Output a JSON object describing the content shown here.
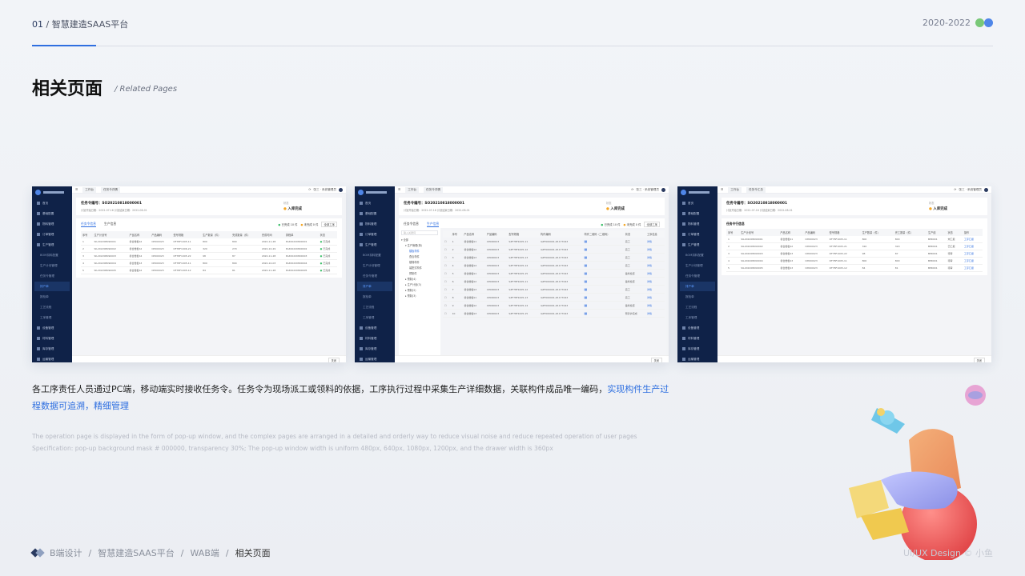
{
  "header": {
    "number": "01",
    "separator": "/",
    "platform": "智慧建造SAAS平台",
    "years": "2020-2022"
  },
  "page": {
    "title": "相关页面",
    "subtitle": "/ Related Pages"
  },
  "shot1": {
    "sidebar": [
      "首页",
      "基础配置",
      "物料管理",
      "订单管理",
      "生产管理",
      "BOM扣料配置",
      "生产计划管理",
      "任务令管理",
      "排产单",
      "报检单",
      "工艺流程",
      "工序管理",
      "设备管理",
      "材料管理",
      "库存管理",
      "运输管理"
    ],
    "active_index": 8,
    "top_tabs": [
      "工作台",
      "任务令详情"
    ],
    "user": "张三 · 系统管理员",
    "task_no": "任务令编号：SO20210818000001",
    "meta": "计划开始日期：2022-07-16    计划结束日期：2022-08-01",
    "status_label": "状态",
    "status": "入库完成",
    "tabs": [
      "任务令信息",
      "生产信息"
    ],
    "legend_done": "已完成 10 件",
    "legend_todo": "未完成 0 件",
    "legend_btn": "全部工序",
    "columns": [
      "序号",
      "生产计划号",
      "产品名称",
      "产品编码",
      "型号规格",
      "生产数量（件）",
      "完成数量（件）",
      "完成时间",
      "排程单",
      "状态"
    ],
    "rows": [
      [
        "1",
        "SIL202208090001",
        "叠合楼板S2",
        "CP000023",
        "DF78F1005-11",
        "800",
        "800",
        "2022-11-28",
        "PLZ20220800001",
        "已完成"
      ],
      [
        "2",
        "SIL202208090002",
        "叠合楼板S2",
        "CP000023",
        "DF78F1006-21",
        "320",
        "270",
        "2022-10-29",
        "PLZ20220800002",
        "已完成"
      ],
      [
        "3",
        "SIL202208090003",
        "叠合楼板S4",
        "CP000023",
        "DF78F1005-22",
        "98",
        "87",
        "2022-11-28",
        "PLZ20220800003",
        "已完成"
      ],
      [
        "4",
        "SIL202208090004",
        "叠合楼板S3",
        "CP000023",
        "DF78F1005-11",
        "800",
        "800",
        "2022-10-03",
        "PLZ20220800004",
        "已完成"
      ],
      [
        "5",
        "SIL202208090005",
        "叠合楼板S2",
        "CP000023",
        "DF78F1005-12",
        "84",
        "81",
        "2022-11-28",
        "PLZ20220800005",
        "已完成"
      ]
    ],
    "footer_btn": "关闭"
  },
  "shot2": {
    "top_tabs": [
      "工作台",
      "任务令详情"
    ],
    "user": "张三 · 系统管理员",
    "tree_search": "输入关键词",
    "tree": [
      {
        "label": "▾ 全部",
        "level": 1
      },
      {
        "label": "▾ 生产管理(单)",
        "level": 2
      },
      {
        "label": "楼板构件",
        "level": 3,
        "sel": true
      },
      {
        "label": "叠合构件",
        "level": 3
      },
      {
        "label": "楼梯构件",
        "level": 3
      },
      {
        "label": "装配式构件",
        "level": 3
      },
      {
        "label": "预制件",
        "level": 3
      },
      {
        "label": "▸ 预制(4)",
        "level": 2
      },
      {
        "label": "▸ 生产计划(3)",
        "level": 2
      },
      {
        "label": "▸ 预制(2)",
        "level": 2
      },
      {
        "label": "▸ 预制(3)",
        "level": 2
      }
    ],
    "columns": [
      "",
      "序号",
      "产品名称",
      "产品编码",
      "型号规格",
      "构件编码",
      "构件二维码（二维码）",
      "状态",
      "工序信息"
    ],
    "rows": [
      [
        "1",
        "叠合楼板S1",
        "CP000023",
        "SZF78F1005-11",
        "GZF000001-Z1177043"
      ],
      [
        "2",
        "叠合楼板S2",
        "CP000023",
        "SZF78F1005-12",
        "GZF000001-Z1177043"
      ],
      [
        "3",
        "叠合楼板S3",
        "CP000023",
        "SZF78F1005-13",
        "GZF000001-Z1177043"
      ],
      [
        "4",
        "叠合楼板S4",
        "CP000023",
        "SZF78F1005-14",
        "GZF000001-Z1177043"
      ],
      [
        "5",
        "叠合楼板S1",
        "CP000023",
        "SZF78F1005-15",
        "GZF000001-Z1177043"
      ],
      [
        "6",
        "叠合楼板S2",
        "CP000023",
        "SZF78F1005-11",
        "GZF000001-Z1177043"
      ],
      [
        "7",
        "叠合楼板S3",
        "CP000023",
        "SZF78F1005-12",
        "GZF000001-Z1177043"
      ],
      [
        "8",
        "叠合楼板S1",
        "CP000023",
        "SZF78F1005-13",
        "GZF000001-Z1177043"
      ],
      [
        "9",
        "叠合楼板S2",
        "CP000023",
        "SZF78F1005-14",
        "GZF000001-Z1177043"
      ],
      [
        "10",
        "叠合楼板S3",
        "CP000023",
        "SZF78F1005-15",
        "GZF000001-Z1177043"
      ]
    ],
    "row_status": [
      "完工",
      "完工",
      "完工",
      "完工",
      "备料检查",
      "备料检查",
      "完工",
      "完工",
      "备料检查",
      "预养护完成"
    ],
    "link": "详情"
  },
  "shot3": {
    "top_tabs": [
      "工作台",
      "任务令汇总"
    ],
    "user": "张三 · 系统管理员",
    "section": "任务令行信息",
    "columns": [
      "序号",
      "生产计划号",
      "产品名称",
      "产品编码",
      "型号规格",
      "生产数量（件）",
      "完工数量（件）",
      "生产线",
      "状态",
      "操作"
    ],
    "rows": [
      [
        "1",
        "SIL202208090001",
        "叠合楼板S1",
        "CP000023",
        "DF78F1005-11",
        "800",
        "800",
        "BPR001",
        "未汇报",
        "工序汇报"
      ],
      [
        "2",
        "SIL202208090002",
        "叠合楼板S2",
        "CP000023",
        "DF78F1005-21",
        "320",
        "320",
        "BPR001",
        "已汇报",
        "工序汇报"
      ],
      [
        "3",
        "SIL202208090003",
        "叠合楼板S3",
        "CP000023",
        "DF78F1005-22",
        "98",
        "87",
        "BPR001",
        "待审",
        "工序汇报"
      ],
      [
        "4",
        "SIL202208090004",
        "叠合楼板S3",
        "CP000023",
        "DF78F1005-11",
        "800",
        "800",
        "BPR001",
        "待审",
        "工序汇报"
      ],
      [
        "5",
        "SIL202208090005",
        "叠合楼板S3",
        "CP000023",
        "DF78F1005-12",
        "84",
        "81",
        "BPR001",
        "待审",
        "工序汇报"
      ]
    ]
  },
  "description": {
    "main": "各工序责任人员通过PC端，移动端实时接收任务令。任务令为现场派工或领料的依据，工序执行过程中采集生产详细数据，关联构件成品唯一编码，",
    "highlight": "实现构件生产过程数据可追溯，精细管理"
  },
  "english": {
    "line1": "The operation page is displayed in the form of pop-up window, and the complex pages are arranged in a detailed and orderly way to reduce visual noise and reduce repeated operation of user pages",
    "line2": "Specification: pop-up background mask # 000000, transparency 30%; The pop-up window width is uniform 480px, 640px, 1080px, 1200px, and the drawer width is 360px"
  },
  "breadcrumb": {
    "items": [
      "B端设计",
      "智慧建造SAAS平台",
      "WAB端"
    ],
    "current": "相关页面",
    "sep": "/"
  },
  "credit": "UI/UX Design © 小鱼",
  "colors": {
    "accent": "#2f6fe0",
    "sidebar": "#0f2248",
    "success": "#3dbf6a",
    "pending": "#f5a623"
  }
}
